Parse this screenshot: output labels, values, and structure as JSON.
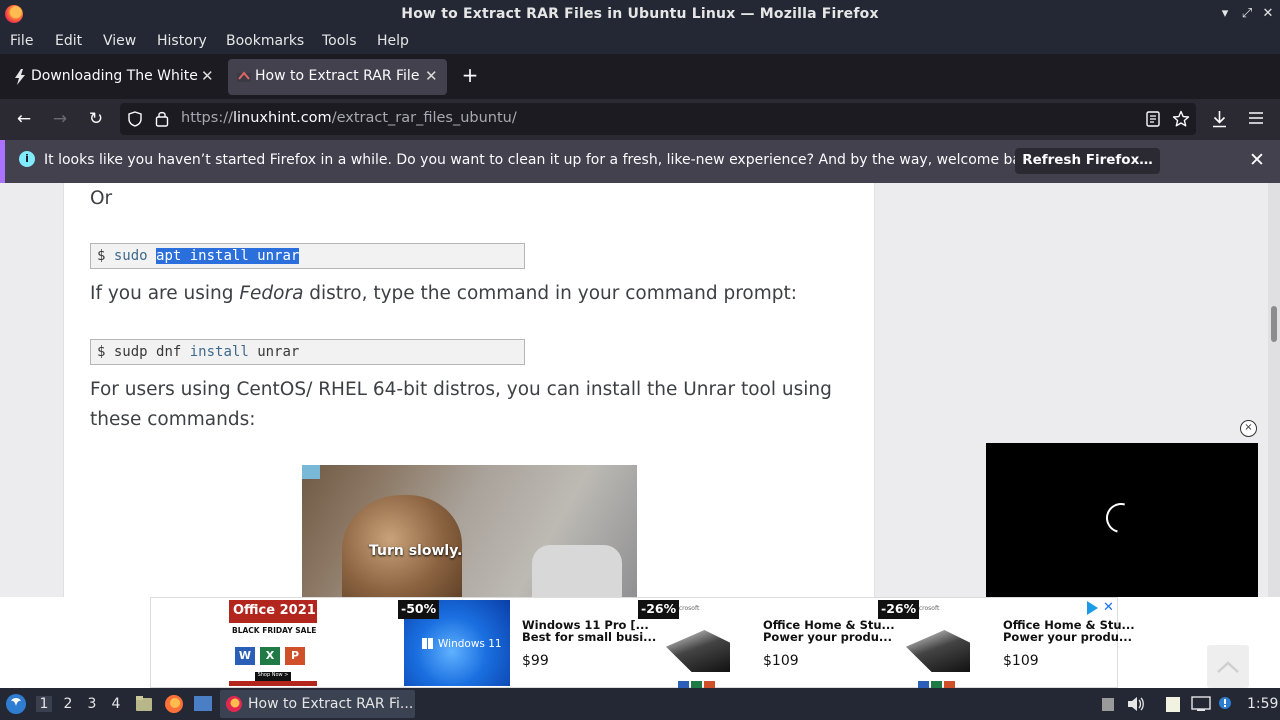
{
  "window": {
    "title": "How to Extract RAR Files in Ubuntu Linux — Mozilla Firefox",
    "minimize": "▾",
    "maximize": "⤢",
    "close": "✕"
  },
  "menu": [
    "File",
    "Edit",
    "View",
    "History",
    "Bookmarks",
    "Tools",
    "Help"
  ],
  "tabs": [
    {
      "label": "Downloading The White House",
      "active": false
    },
    {
      "label": "How to Extract RAR Files in Ubuntu Linux",
      "active": true
    }
  ],
  "tab_close": "✕",
  "new_tab": "+",
  "nav": {
    "back": "←",
    "forward": "→",
    "reload": "↻",
    "url_prefix": "https://",
    "url_domain": "linuxhint.com",
    "url_path": "/extract_rar_files_ubuntu/"
  },
  "notification": {
    "message": "It looks like you haven’t started Firefox in a while. Do you want to clean it up for a fresh, like-new experience? And by the way, welcome back!",
    "button": "Refresh Firefox…",
    "close": "✕",
    "accent": "#ab71ff"
  },
  "article": {
    "or_text": "Or",
    "code1": {
      "prompt": "$",
      "cmd": "sudo",
      "selected": "apt install unrar"
    },
    "fedora_pre": "If you are using ",
    "fedora_em": "Fedora",
    "fedora_post": " distro, type the command in your command prompt:",
    "code2": {
      "prompt": "$",
      "cmd": "sudp dnf",
      "kw": "install",
      "rest": "unrar"
    },
    "centos_line1": "For users using CentOS/ RHEL 64-bit distros, you can install the Unrar tool using",
    "centos_line2": "these commands:",
    "ad_text": "Turn slowly."
  },
  "video_close": "×",
  "ads": {
    "office2021": {
      "title": "Office 2021",
      "sub": "BLACK FRIDAY SALE",
      "shop": "Shop Now >"
    },
    "items": [
      {
        "badge": "-50%",
        "image_text": "Windows 11",
        "title1": "Windows 11 Pro [...",
        "title2": "Best for small busi...",
        "price": "$99"
      },
      {
        "badge": "-26%",
        "image_text": "Microsoft",
        "title1": "Office Home & Stu...",
        "title2": "Power your produ...",
        "price": "$109"
      },
      {
        "badge": "-26%",
        "image_text": "Microsoft",
        "title1": "Office Home & Stu...",
        "title2": "Power your produ...",
        "price": "$109"
      }
    ],
    "close": "✕"
  },
  "taskbar": {
    "workspaces": [
      "1",
      "2",
      "3",
      "4"
    ],
    "active_task": "How to Extract RAR Fi...",
    "clock": "1:59"
  }
}
